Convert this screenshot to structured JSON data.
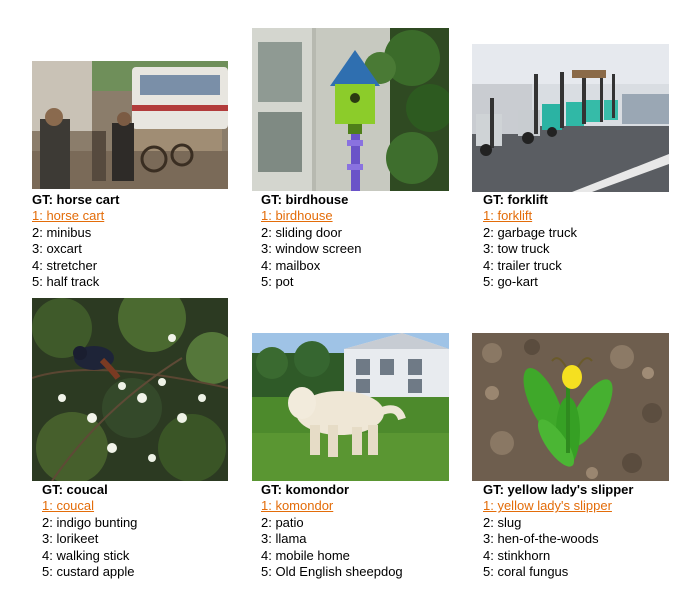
{
  "panels": [
    {
      "gt": "GT: horse cart",
      "preds": [
        "1: horse cart",
        "2: minibus",
        "3: oxcart",
        "4: stretcher",
        "5: half track"
      ],
      "image": "horse cart street scene photo"
    },
    {
      "gt": "GT: birdhouse",
      "preds": [
        "1: birdhouse",
        "2: sliding door",
        "3: window screen",
        "4: mailbox",
        "5: pot"
      ],
      "image": "green birdhouse on pole photo"
    },
    {
      "gt": "GT: forklift",
      "preds": [
        "1: forklift",
        "2: garbage truck",
        "3: tow truck",
        "4: trailer truck",
        "5: go-kart"
      ],
      "image": "row of forklifts photo"
    },
    {
      "gt": "GT: coucal",
      "preds": [
        "1: coucal",
        "2: indigo bunting",
        "3: lorikeet",
        "4: walking stick",
        "5: custard apple"
      ],
      "image": "bird in flowering bush photo"
    },
    {
      "gt": "GT: komondor",
      "preds": [
        "1: komondor",
        "2: patio",
        "3: llama",
        "4: mobile home",
        "5: Old English sheepdog"
      ],
      "image": "komondor dog on lawn photo"
    },
    {
      "gt": "GT: yellow lady's slipper",
      "preds": [
        "1: yellow lady's slipper",
        "2: slug",
        "3: hen-of-the-woods",
        "4: stinkhorn",
        "5: coral fungus"
      ],
      "image": "yellow lady's slipper orchid photo"
    }
  ],
  "colors": {
    "correct_prediction": "#e36c09",
    "text": "#000000"
  }
}
